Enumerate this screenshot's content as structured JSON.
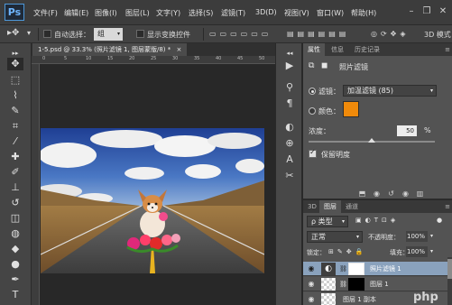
{
  "app": {
    "logo": "Ps"
  },
  "menu": [
    "文件(F)",
    "编辑(E)",
    "图像(I)",
    "图层(L)",
    "文字(Y)",
    "选择(S)",
    "滤镜(T)",
    "3D(D)",
    "视图(V)",
    "窗口(W)",
    "帮助(H)"
  ],
  "window_controls": {
    "minimize": "–",
    "restore": "❐",
    "close": "✕"
  },
  "options_bar": {
    "auto_select_label": "自动选择：",
    "auto_select_value": "组",
    "show_transform_label": "显示变换控件",
    "mode_label": "3D 模式"
  },
  "document": {
    "tab_title": "1-5.psd @ 33.3% (照片滤镜 1, 图层蒙版/8) *",
    "ruler_h": [
      "0",
      "5",
      "10",
      "15",
      "20",
      "25",
      "30",
      "35",
      "40",
      "45",
      "50"
    ],
    "ruler_v": [
      "0",
      "5",
      "1\n0",
      "1\n5",
      "2\n0",
      "2\n5",
      "3\n0",
      "3\n5",
      "4\n0"
    ]
  },
  "properties_panel": {
    "tabs": [
      "属性",
      "信息",
      "历史记录"
    ],
    "title": "照片滤镜",
    "filter_label": "滤镜：",
    "filter_value": "加温滤镜 (85)",
    "color_label": "颜色：",
    "color_swatch": "#f08a0a",
    "density_label": "浓度：",
    "density_value": "50",
    "density_unit": "%",
    "density_fraction": 0.5,
    "preserve_label": "保留明度"
  },
  "layers_panel": {
    "tabs": [
      "3D",
      "图层",
      "通道"
    ],
    "kind_label": "ρ 类型",
    "blend_mode": "正常",
    "opacity_label": "不透明度：",
    "opacity_value": "100%",
    "lock_label": "锁定：",
    "fill_label": "填充：",
    "fill_value": "100%",
    "layers": [
      {
        "name": "照片滤镜 1",
        "selected": true
      },
      {
        "name": "图层 1",
        "selected": false
      },
      {
        "name": "图层 1 副本",
        "selected": false
      }
    ]
  },
  "watermark": "php"
}
